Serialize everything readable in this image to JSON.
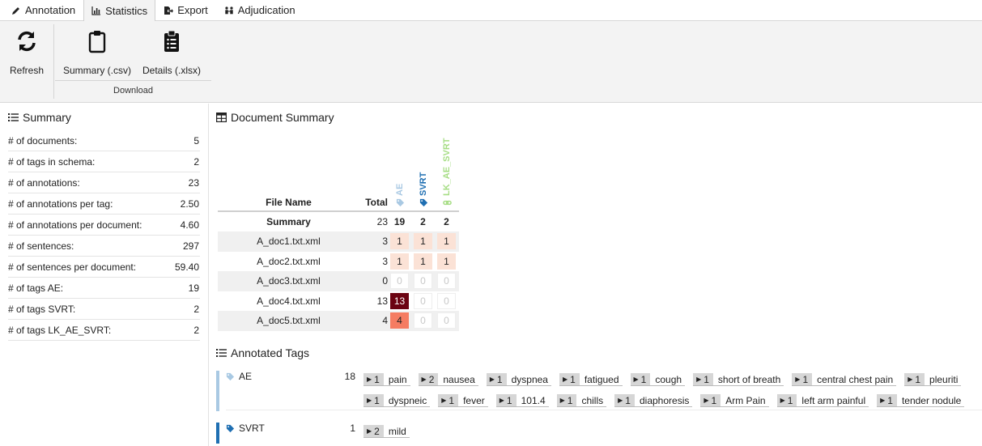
{
  "tabs": [
    {
      "label": "Annotation",
      "icon": "pen-icon"
    },
    {
      "label": "Statistics",
      "icon": "bar-chart-icon",
      "active": true
    },
    {
      "label": "Export",
      "icon": "export-icon"
    },
    {
      "label": "Adjudication",
      "icon": "users-icon"
    }
  ],
  "ribbon": {
    "refresh_label": "Refresh",
    "summary_csv_label": "Summary (.csv)",
    "details_xlsx_label": "Details (.xlsx)",
    "download_group_label": "Download"
  },
  "summary": {
    "title": "Summary",
    "stats": [
      {
        "label": "# of documents:",
        "value": "5"
      },
      {
        "label": "# of tags in schema:",
        "value": "2"
      },
      {
        "label": "# of annotations:",
        "value": "23"
      },
      {
        "label": "# of annotations per tag:",
        "value": "2.50"
      },
      {
        "label": "# of annotations per document:",
        "value": "4.60"
      },
      {
        "label": "# of sentences:",
        "value": "297"
      },
      {
        "label": "# of sentences per document:",
        "value": "59.40"
      },
      {
        "label": "# of tags AE:",
        "value": "19"
      },
      {
        "label": "# of tags SVRT:",
        "value": "2"
      },
      {
        "label": "# of tags LK_AE_SVRT:",
        "value": "2"
      }
    ]
  },
  "doc_summary": {
    "title": "Document Summary",
    "col_file_name": "File Name",
    "col_total": "Total",
    "tag_columns": [
      {
        "label": "AE",
        "color": "#a9c9e3",
        "icon": "tag-icon"
      },
      {
        "label": "SVRT",
        "color": "#1f6fb2",
        "icon": "tag-icon"
      },
      {
        "label": "LK_AE_SVRT",
        "color": "#a6dd84",
        "icon": "link-icon"
      }
    ],
    "summary_row": {
      "name": "Summary",
      "total": "23",
      "counts": [
        "19",
        "2",
        "2"
      ]
    },
    "rows": [
      {
        "name": "A_doc1.txt.xml",
        "total": "3",
        "counts": [
          "1",
          "1",
          "1"
        ],
        "colors": [
          "#fbe2d6",
          "#fbe2d6",
          "#fbe2d6"
        ]
      },
      {
        "name": "A_doc2.txt.xml",
        "total": "3",
        "counts": [
          "1",
          "1",
          "1"
        ],
        "colors": [
          "#fbe2d6",
          "#fbe2d6",
          "#fbe2d6"
        ]
      },
      {
        "name": "A_doc3.txt.xml",
        "total": "0",
        "counts": [
          "0",
          "0",
          "0"
        ],
        "colors": [
          "",
          "",
          ""
        ]
      },
      {
        "name": "A_doc4.txt.xml",
        "total": "13",
        "counts": [
          "13",
          "0",
          "0"
        ],
        "colors": [
          "#6b0312",
          "",
          ""
        ]
      },
      {
        "name": "A_doc5.txt.xml",
        "total": "4",
        "counts": [
          "4",
          "0",
          "0"
        ],
        "colors": [
          "#f57c62",
          "",
          ""
        ]
      }
    ]
  },
  "annotated_tags": {
    "title": "Annotated Tags",
    "groups": [
      {
        "tag": "AE",
        "count": "18",
        "color": "#a9c9e3",
        "lines": [
          [
            {
              "n": "1",
              "text": "pain"
            },
            {
              "n": "2",
              "text": "nausea"
            },
            {
              "n": "1",
              "text": "dyspnea"
            },
            {
              "n": "1",
              "text": "fatigued"
            },
            {
              "n": "1",
              "text": "cough"
            },
            {
              "n": "1",
              "text": "short of breath"
            },
            {
              "n": "1",
              "text": "central chest pain"
            },
            {
              "n": "1",
              "text": "pleuriti"
            }
          ],
          [
            {
              "n": "1",
              "text": "dyspneic"
            },
            {
              "n": "1",
              "text": "fever"
            },
            {
              "n": "1",
              "text": "101.4"
            },
            {
              "n": "1",
              "text": "chills"
            },
            {
              "n": "1",
              "text": "diaphoresis"
            },
            {
              "n": "1",
              "text": "Arm Pain"
            },
            {
              "n": "1",
              "text": "left arm painful"
            },
            {
              "n": "1",
              "text": "tender nodule"
            }
          ]
        ]
      },
      {
        "tag": "SVRT",
        "count": "1",
        "color": "#1f6fb2",
        "lines": [
          [
            {
              "n": "2",
              "text": "mild"
            }
          ]
        ]
      }
    ]
  }
}
